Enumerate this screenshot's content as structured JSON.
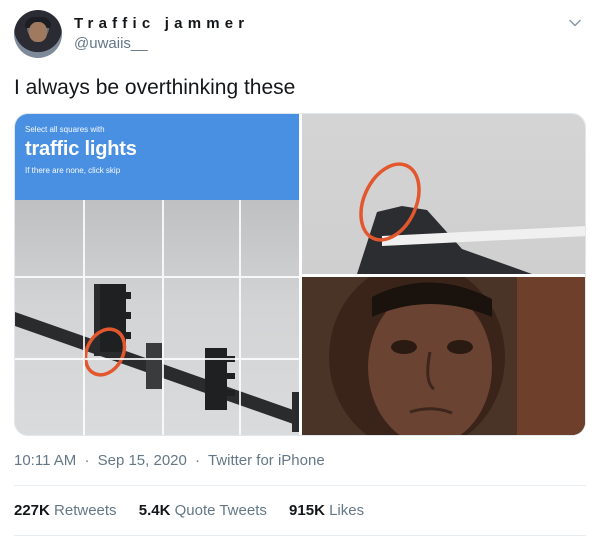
{
  "user": {
    "display_name": "Traffic jammer",
    "handle": "@uwaiis__"
  },
  "icons": {
    "avatar": "avatar-photo",
    "more": "chevron-down-icon"
  },
  "tweet": {
    "text": "I always be overthinking these"
  },
  "media": {
    "captcha": {
      "instruction": "Select all squares with",
      "target": "traffic lights",
      "note": "If there are none, click skip"
    },
    "colors": {
      "captcha_blue": "#4a90e2",
      "circle_red": "#e2572e"
    }
  },
  "meta": {
    "time": "10:11 AM",
    "date": "Sep 15, 2020",
    "source": "Twitter for iPhone",
    "separator": "·"
  },
  "stats": {
    "retweets_count": "227K",
    "retweets_label": "Retweets",
    "quote_count": "5.4K",
    "quote_label": "Quote Tweets",
    "likes_count": "915K",
    "likes_label": "Likes"
  }
}
